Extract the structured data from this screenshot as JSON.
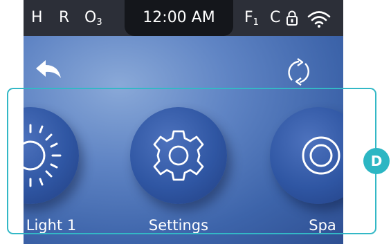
{
  "status_bar": {
    "left_indicators": [
      {
        "label": "H"
      },
      {
        "label": "R"
      },
      {
        "label": "O",
        "sub": "3"
      }
    ],
    "time": "12:00 AM",
    "right_indicators": [
      {
        "label": "F",
        "sub": "1"
      },
      {
        "label": "C"
      }
    ],
    "icons": [
      "lock-icon",
      "wifi-icon"
    ]
  },
  "nav": {
    "back_icon": "back-arrow-icon",
    "refresh_icon": "refresh-icon"
  },
  "carousel": {
    "items": [
      {
        "label": "Light 1",
        "icon": "light-icon"
      },
      {
        "label": "Settings",
        "icon": "gear-icon"
      },
      {
        "label": "Spa",
        "icon": "spa-icon"
      }
    ]
  },
  "annotation": {
    "badge_label": "D",
    "frame_color": "#33b8c6",
    "badge_color": "#2cb6c3"
  }
}
